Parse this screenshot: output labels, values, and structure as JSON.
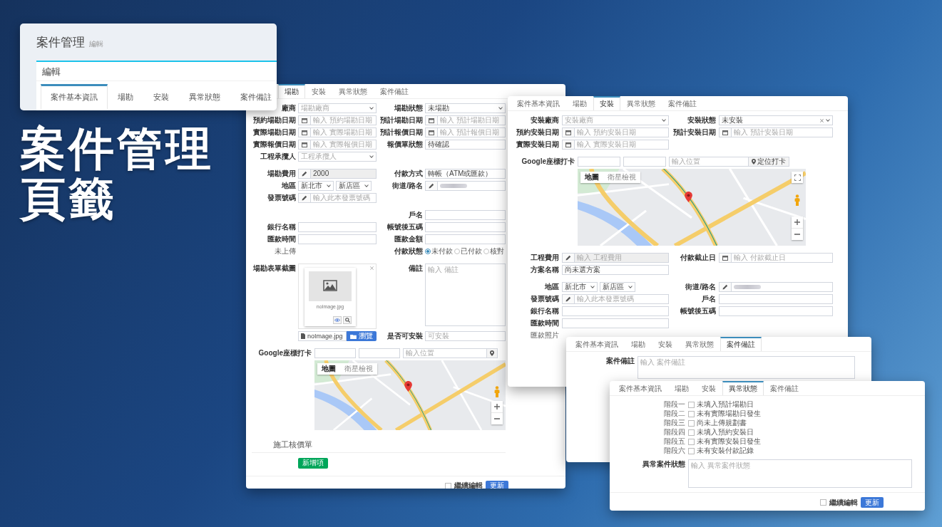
{
  "headline": [
    "案件管理",
    "頁籤"
  ],
  "edit_card": {
    "title": "案件管理",
    "subtitle": "編輯",
    "panel_title": "編輯",
    "tabs": [
      {
        "label": "案件基本資訊",
        "selected": true
      },
      {
        "label": "場勘",
        "selected": false
      },
      {
        "label": "安裝",
        "selected": false
      },
      {
        "label": "異常狀態",
        "selected": false
      },
      {
        "label": "案件備註",
        "selected": false
      }
    ]
  },
  "windows": [
    {
      "tabs": [
        {
          "label": "場勘",
          "selected": true
        },
        {
          "label": "安裝",
          "selected": false
        },
        {
          "label": "異常狀態",
          "selected": false
        },
        {
          "label": "案件備註",
          "selected": false
        }
      ],
      "sections": [
        {
          "rows": [
            {
              "kind": "fields",
              "left": {
                "label": "廠商",
                "kind": "select",
                "placeholder": "場勘廠商"
              },
              "right": {
                "label": "場勘狀態",
                "kind": "select",
                "value": "未場勘"
              }
            },
            {
              "kind": "fields",
              "left": {
                "label": "預約場勘日期",
                "kind": "date",
                "placeholder": "輸入 預約場勘日期"
              },
              "right": {
                "label": "預計場勘日期",
                "kind": "date",
                "placeholder": "輸入 預計場勘日期"
              }
            },
            {
              "kind": "fields",
              "left": {
                "label": "實際場勘日期",
                "kind": "date",
                "placeholder": "輸入 實際場勘日期"
              },
              "right": {
                "label": "預計報價日期",
                "kind": "date",
                "placeholder": "輸入 預計報價日期"
              }
            },
            {
              "kind": "fields",
              "left": {
                "label": "實際報價日期",
                "kind": "date",
                "placeholder": "輸入 實際報價日期"
              },
              "right": {
                "label": "報價單狀態",
                "kind": "text",
                "value": "待確認"
              }
            },
            {
              "kind": "fields",
              "left": {
                "label": "工程承攬人",
                "kind": "select",
                "placeholder": "工程承攬人"
              }
            }
          ]
        },
        {
          "rows": [
            {
              "kind": "fields",
              "left": {
                "label": "場勘費用",
                "kind": "pencil",
                "value": "2000",
                "disabled": true
              },
              "right": {
                "label": "付款方式",
                "kind": "text",
                "value": "轉帳（ATM或匯款）"
              }
            },
            {
              "kind": "fields",
              "left": {
                "label": "地區",
                "kind": "region",
                "values": [
                  "新北市",
                  "新店區"
                ]
              },
              "right": {
                "label": "街道/路名",
                "kind": "blurred"
              }
            },
            {
              "kind": "fields",
              "left": {
                "label": "發票號碼",
                "kind": "pencil",
                "placeholder": "輸入此本發票號碼"
              }
            }
          ]
        },
        {
          "rows": [
            {
              "kind": "fields",
              "right": {
                "label": "戶名",
                "kind": "text"
              }
            },
            {
              "kind": "fields",
              "left": {
                "label": "銀行名稱",
                "kind": "text"
              },
              "right": {
                "label": "帳號後五碼",
                "kind": "text"
              }
            },
            {
              "kind": "fields",
              "left": {
                "label": "匯款時間",
                "kind": "text"
              },
              "right": {
                "label": "匯款金額",
                "kind": "text"
              }
            },
            {
              "kind": "fields",
              "left": {
                "kind": "note",
                "text": "未上傳"
              },
              "right": {
                "label": "付款狀態",
                "kind": "radio",
                "options": [
                  {
                    "label": "未付款",
                    "selected": true
                  },
                  {
                    "label": "已付款",
                    "selected": false
                  },
                  {
                    "label": "核對",
                    "selected": false
                  }
                ]
              }
            }
          ]
        },
        {
          "rows": [
            {
              "kind": "fields",
              "left": {
                "label": "場勘表單截圖",
                "kind": "preview",
                "caption": "noImage.jpg"
              },
              "right": {
                "label": "備註",
                "kind": "textarea",
                "placeholder": "輸入 備註"
              }
            },
            {
              "kind": "fields",
              "left": {
                "kind": "file",
                "value": "noImage.jpg",
                "button": "瀏覽"
              },
              "right": {
                "label": "是否可安裝",
                "kind": "text",
                "placeholder": "可安裝"
              }
            }
          ]
        },
        {
          "rows": [
            {
              "kind": "geo",
              "label": "Google座標打卡",
              "placeholder": "輸入位置"
            },
            {
              "kind": "map",
              "types": [
                {
                  "label": "地圖",
                  "selected": true
                },
                {
                  "label": "衛星檢視",
                  "selected": false
                }
              ]
            }
          ]
        },
        {
          "rows": [
            {
              "kind": "heading",
              "text": "施工核價單"
            },
            {
              "kind": "button",
              "label": "新增項"
            }
          ]
        }
      ],
      "footer": {
        "checkbox": {
          "label": "繼續編輯",
          "checked": false
        },
        "button": "更新"
      }
    },
    {
      "tabs": [
        {
          "label": "案件基本資訊",
          "selected": false
        },
        {
          "label": "場勘",
          "selected": false
        },
        {
          "label": "安裝",
          "selected": true
        },
        {
          "label": "異常狀態",
          "selected": false
        },
        {
          "label": "案件備註",
          "selected": false
        }
      ],
      "sections": [
        {
          "rows": [
            {
              "kind": "fields",
              "left": {
                "label": "安裝廠商",
                "kind": "select",
                "placeholder": "安裝廠商"
              },
              "right": {
                "label": "安裝狀態",
                "kind": "select",
                "value": "未安裝",
                "clearable": true
              }
            },
            {
              "kind": "fields",
              "left": {
                "label": "預約安裝日期",
                "kind": "date",
                "placeholder": "輸入 預約安裝日期"
              },
              "right": {
                "label": "預計安裝日期",
                "kind": "date",
                "placeholder": "輸入 預計安裝日期"
              }
            },
            {
              "kind": "fields",
              "left": {
                "label": "實際安裝日期",
                "kind": "date",
                "placeholder": "輸入 實際安裝日期"
              }
            }
          ]
        },
        {
          "rows": [
            {
              "kind": "geo",
              "label": "Google座標打卡",
              "placeholder": "輸入位置",
              "button": "定位打卡"
            },
            {
              "kind": "map",
              "types": [
                {
                  "label": "地圖",
                  "selected": true
                },
                {
                  "label": "衛星檢視",
                  "selected": false
                }
              ],
              "fullscreen": true
            }
          ]
        },
        {
          "rows": [
            {
              "kind": "fields",
              "left": {
                "label": "工程費用",
                "kind": "pencil",
                "placeholder": "輸入 工程費用",
                "disabled": true
              },
              "right": {
                "label": "付款截止日",
                "kind": "date",
                "placeholder": "輸入 付款截止日"
              }
            },
            {
              "kind": "fields",
              "left": {
                "label": "方案名稱",
                "kind": "text",
                "value": "尚未選方案"
              }
            }
          ]
        },
        {
          "rows": [
            {
              "kind": "fields",
              "left": {
                "label": "地區",
                "kind": "region",
                "values": [
                  "新北市",
                  "新店區"
                ]
              },
              "right": {
                "label": "街道/路名",
                "kind": "blurred"
              }
            },
            {
              "kind": "fields",
              "left": {
                "label": "發票號碼",
                "kind": "pencil",
                "placeholder": "輸入此本發票號碼"
              },
              "right": {
                "label": "戶名",
                "kind": "text"
              }
            },
            {
              "kind": "fields",
              "left": {
                "label": "銀行名稱",
                "kind": "text"
              },
              "right": {
                "label": "帳號後五碼",
                "kind": "text"
              }
            },
            {
              "kind": "fields",
              "left": {
                "label": "匯款時間",
                "kind": "text"
              }
            },
            {
              "kind": "fields",
              "left": {
                "kind": "note",
                "text": "匯款照片"
              }
            }
          ]
        }
      ]
    },
    {
      "tabs": [
        {
          "label": "案件基本資訊",
          "selected": false
        },
        {
          "label": "場勘",
          "selected": false
        },
        {
          "label": "安裝",
          "selected": false
        },
        {
          "label": "異常狀態",
          "selected": false
        },
        {
          "label": "案件備註",
          "selected": true
        }
      ],
      "sections": [
        {
          "rows": [
            {
              "kind": "fields",
              "left": {
                "label": "案件備註",
                "kind": "textarea",
                "placeholder": "輸入 案件備註"
              }
            }
          ]
        }
      ]
    },
    {
      "tabs": [
        {
          "label": "案件基本資訊",
          "selected": false
        },
        {
          "label": "場勘",
          "selected": false
        },
        {
          "label": "安裝",
          "selected": false
        },
        {
          "label": "異常狀態",
          "selected": true
        },
        {
          "label": "案件備註",
          "selected": false
        }
      ],
      "sections": [
        {
          "rows": [
            {
              "kind": "check",
              "stage": "階段一",
              "text": "未填入預計場勘日",
              "checked": false
            },
            {
              "kind": "check",
              "stage": "階段二",
              "text": "未有實際場勘日發生",
              "checked": false
            },
            {
              "kind": "check",
              "stage": "階段三",
              "text": "尚未上傳規劃書",
              "checked": false
            },
            {
              "kind": "check",
              "stage": "階段四",
              "text": "未填入預約安裝日",
              "checked": false
            },
            {
              "kind": "check",
              "stage": "階段五",
              "text": "未有實際安裝日發生",
              "checked": false
            },
            {
              "kind": "check",
              "stage": "階段六",
              "text": "未有安裝付款記錄",
              "checked": false
            }
          ]
        },
        {
          "rows": [
            {
              "kind": "fields",
              "left": {
                "label": "異常案件狀態",
                "kind": "textarea",
                "placeholder": "輸入 異常案件狀態"
              }
            }
          ]
        }
      ],
      "footer": {
        "checkbox": {
          "label": "繼續編輯",
          "checked": false
        },
        "button": "更新"
      }
    }
  ]
}
